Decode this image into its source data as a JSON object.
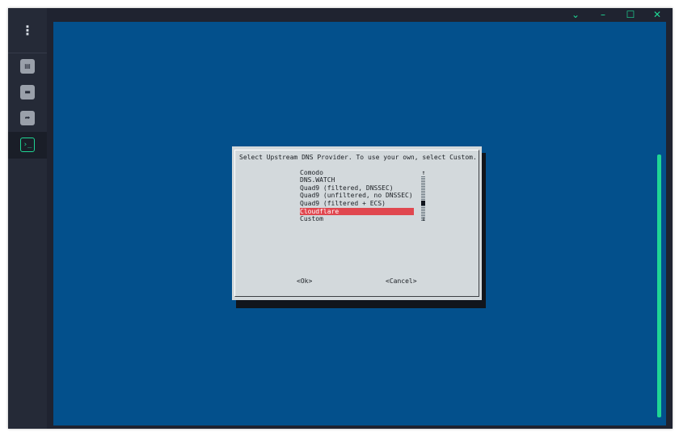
{
  "sidebar": {
    "menu_icon": "kebab-menu-icon",
    "items": [
      {
        "name": "data-icon",
        "glyph": "▤"
      },
      {
        "name": "folder-icon",
        "glyph": "▬"
      },
      {
        "name": "share-arrow-icon",
        "glyph": "➦"
      }
    ],
    "active_item": {
      "name": "terminal-icon",
      "glyph": "›_"
    }
  },
  "window_controls": {
    "dropdown": "⌄",
    "minimize": "–",
    "maximize": "☐",
    "close": "✕"
  },
  "dialog": {
    "title": "Select Upstream DNS Provider. To use your own, select Custom.",
    "options": [
      {
        "label": "Comodo",
        "selected": false
      },
      {
        "label": "DNS.WATCH",
        "selected": false
      },
      {
        "label": "Quad9 (filtered, DNSSEC)",
        "selected": false
      },
      {
        "label": "Quad9 (unfiltered, no DNSSEC)",
        "selected": false
      },
      {
        "label": "Quad9 (filtered + ECS)",
        "selected": false
      },
      {
        "label": "Cloudflare",
        "selected": true
      },
      {
        "label": "Custom",
        "selected": false
      }
    ],
    "scroll_up": "↑",
    "scroll_down": "↓",
    "ok_label": "<Ok>",
    "cancel_label": "<Cancel>"
  },
  "colors": {
    "terminal_bg": "#03508c",
    "dialog_bg": "#d3d9dc",
    "selection": "#e0474f",
    "accent": "#1fd694"
  }
}
